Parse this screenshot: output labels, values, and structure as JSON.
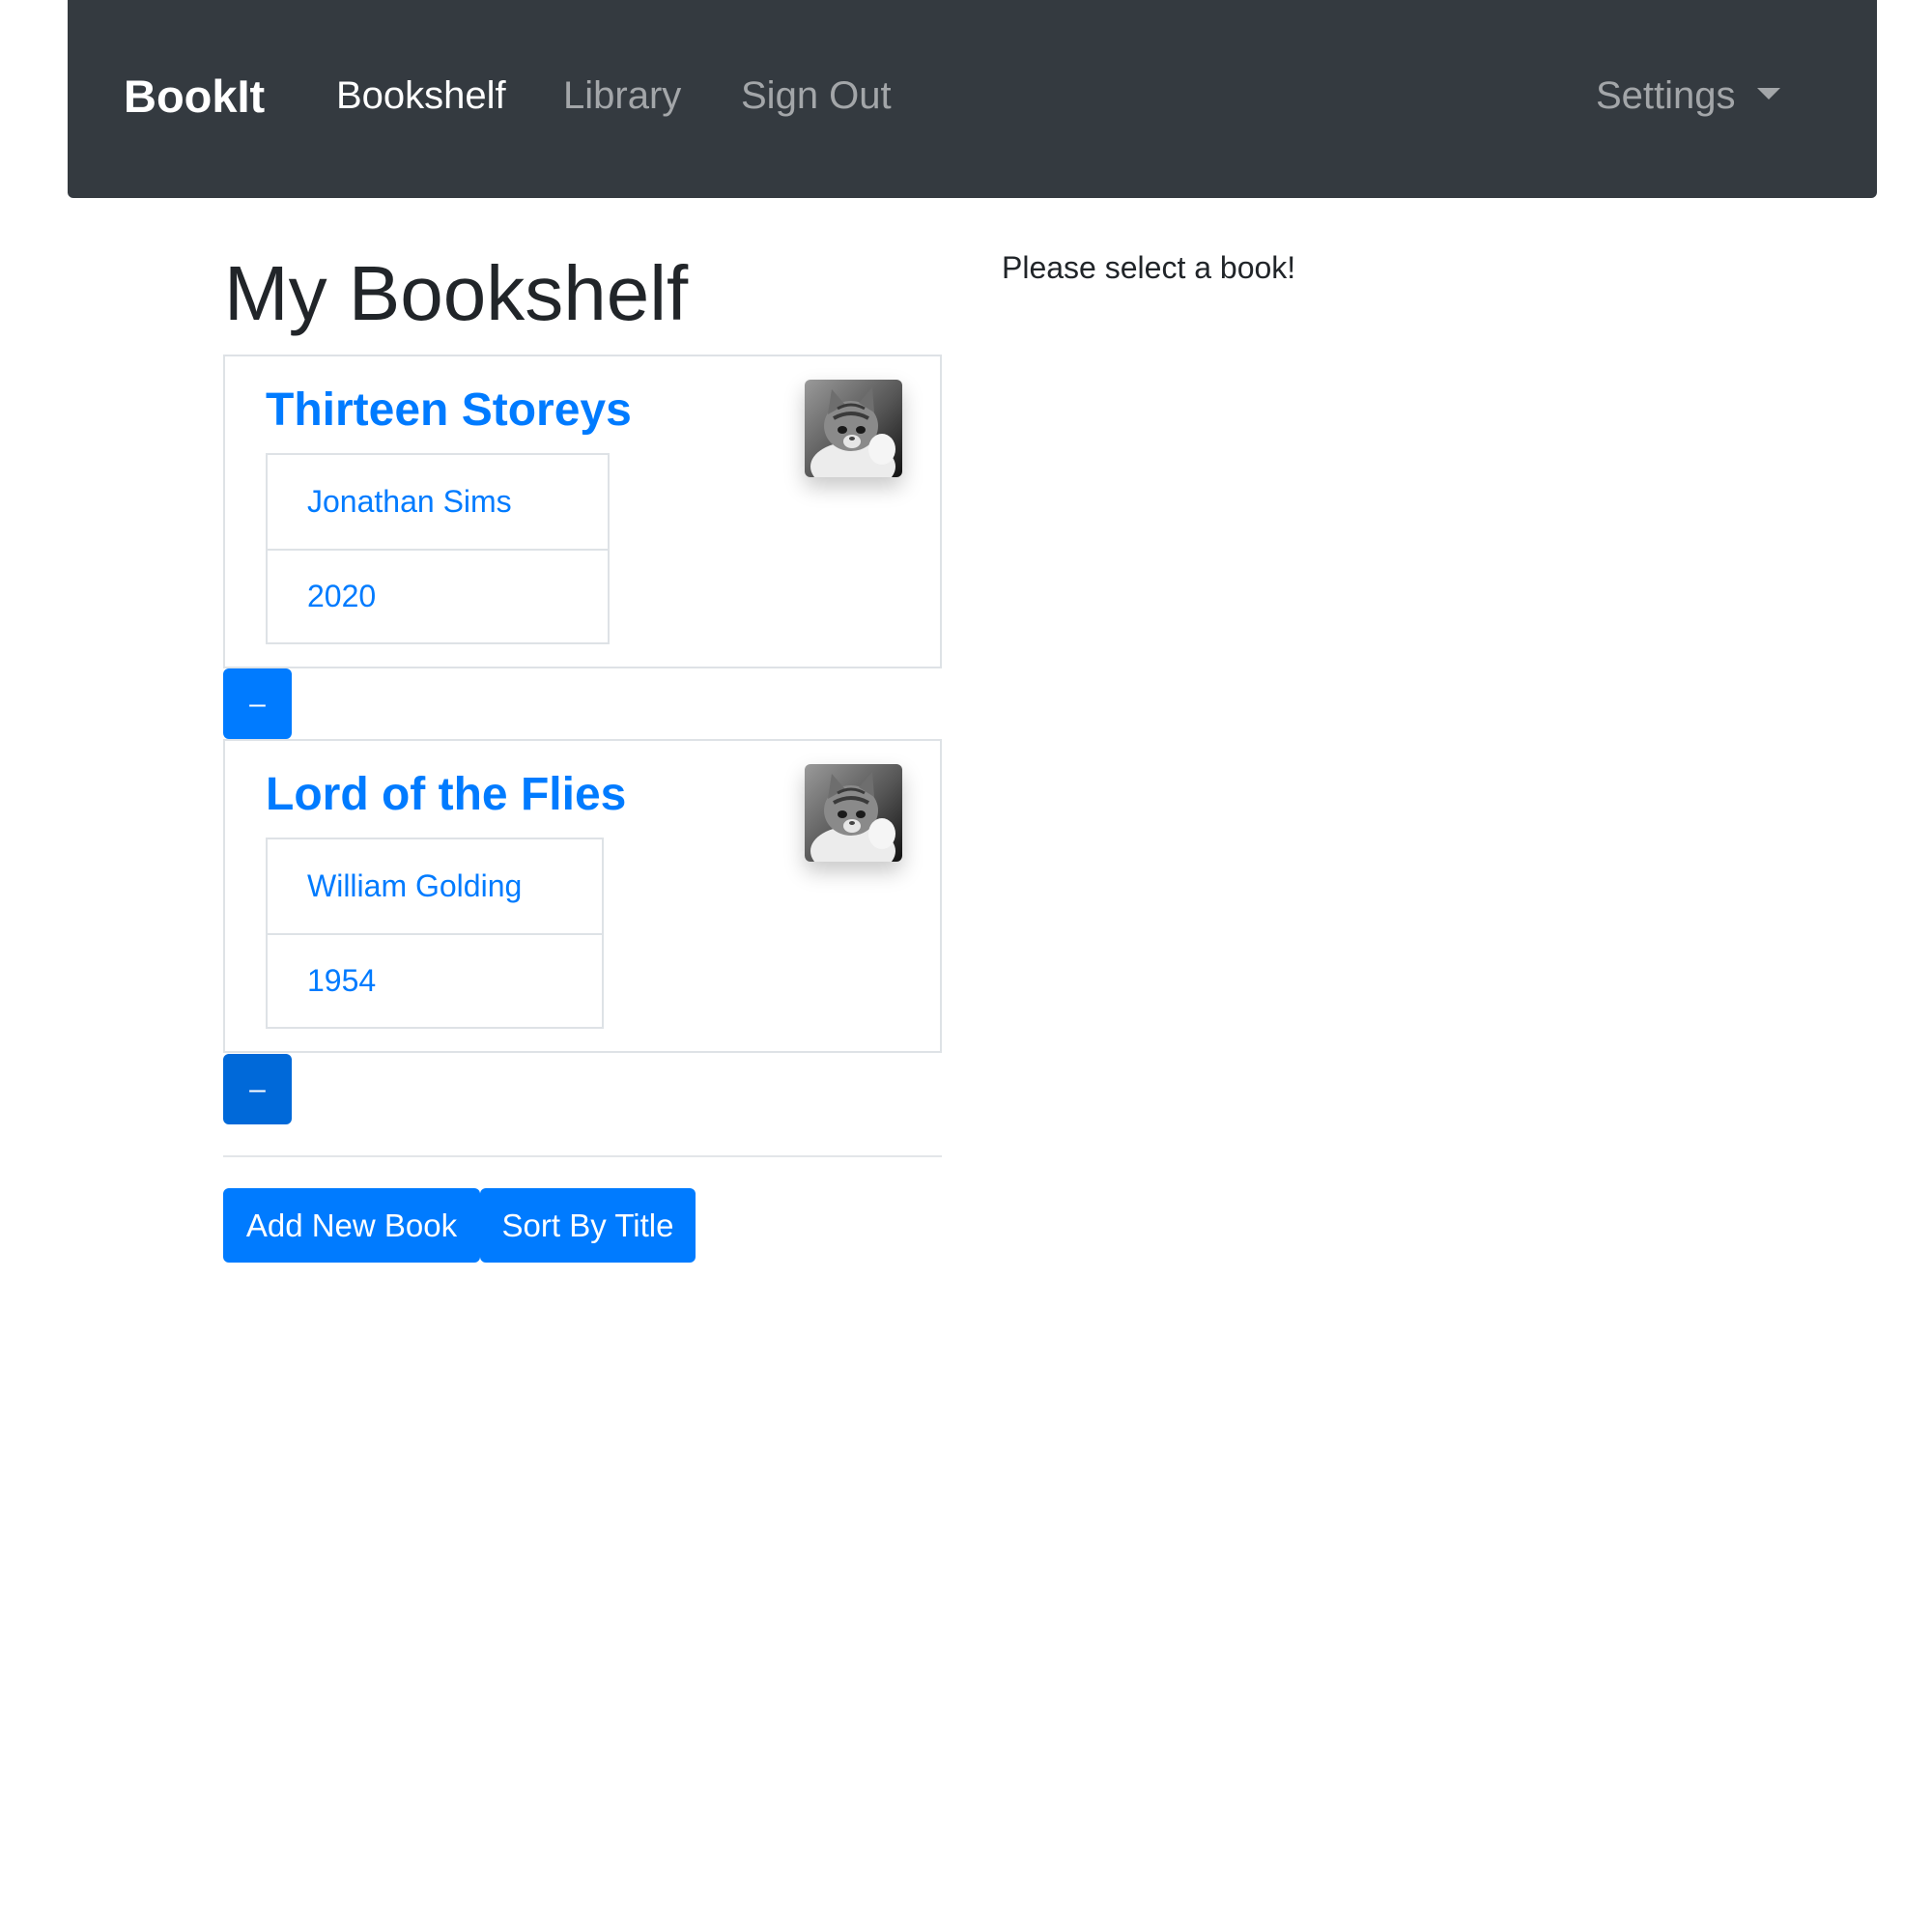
{
  "navbar": {
    "brand": "BookIt",
    "links": [
      {
        "label": "Bookshelf",
        "active": true
      },
      {
        "label": "Library",
        "active": false
      },
      {
        "label": "Sign Out",
        "active": false
      }
    ],
    "settings_label": "Settings",
    "background_color": "#343a40"
  },
  "main": {
    "title": "My Bookshelf",
    "empty_message": "Please select a book!",
    "books": [
      {
        "title": "Thirteen Storeys",
        "author": "Jonathan Sims",
        "year": "2020",
        "remove_label": "–",
        "thumbnail": "kitten-photo"
      },
      {
        "title": "Lord of the Flies",
        "author": "William Golding",
        "year": "1954",
        "remove_label": "–",
        "thumbnail": "kitten-photo"
      }
    ],
    "actions": {
      "add_label": "Add New Book",
      "sort_label": "Sort By Title"
    }
  },
  "colors": {
    "primary": "#007bff",
    "text": "#212529",
    "border": "#dee2e6"
  }
}
